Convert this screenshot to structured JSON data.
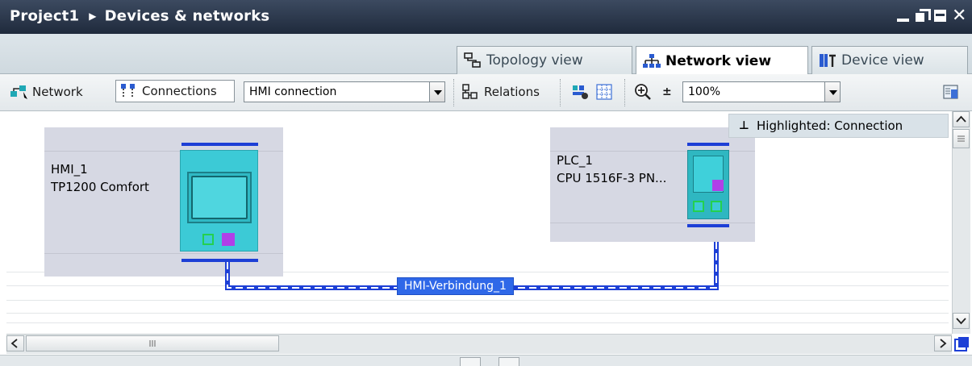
{
  "title": {
    "project": "Project1",
    "editor": "Devices & networks"
  },
  "tabs": [
    {
      "label": "Topology view",
      "icon": "topology-icon",
      "active": false
    },
    {
      "label": "Network view",
      "icon": "network-icon",
      "active": true
    },
    {
      "label": "Device view",
      "icon": "device-icon",
      "active": false
    }
  ],
  "toolbar": {
    "network_label": "Network",
    "connections_label": "Connections",
    "connection_type": "HMI connection",
    "relations_label": "Relations",
    "zoom": "100%"
  },
  "tooltip": {
    "text": "Highlighted: Connection"
  },
  "devices": [
    {
      "name": "HMI_1",
      "type": "TP1200 Comfort"
    },
    {
      "name": "PLC_1",
      "type": "CPU 1516F-3 PN..."
    }
  ],
  "connection": {
    "label": "HMI-Verbindung_1"
  },
  "colors": {
    "titlebar": "#2a3649",
    "device_bg": "#d6d8e3",
    "subnet_bar": "#1d3fd6",
    "connection_label_bg": "#2f68e8",
    "hmi_body": "#3ccad6",
    "port_green": "#24d04f",
    "port_purple": "#b040e8"
  }
}
